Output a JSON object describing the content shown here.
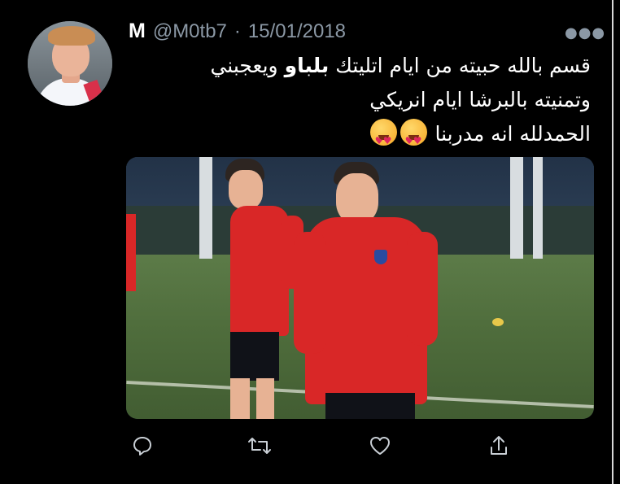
{
  "tweet": {
    "display_name": "M",
    "handle": "@M0tb7",
    "separator": "·",
    "date": "15/01/2018",
    "more_icon": "more-horizontal-icon",
    "text_lines": [
      {
        "before": "قسم بالله حبيته من ايام اتليتك ",
        "bold": "بلباو",
        "after": " ويعجبني"
      },
      {
        "before": "وتمنيته بالبرشا ايام انريكي",
        "bold": "",
        "after": ""
      },
      {
        "before": "الحمدلله انه مدربنا ",
        "bold": "",
        "after": ""
      }
    ],
    "emojis": [
      "heart-eyes-emoji",
      "heart-eyes-emoji"
    ],
    "media": {
      "kind": "photo",
      "subject": "coaches smiling on a training pitch"
    }
  },
  "actions": {
    "reply_icon": "reply-icon",
    "retweet_icon": "retweet-icon",
    "like_icon": "heart-icon",
    "share_icon": "share-icon"
  },
  "colors": {
    "background": "#000000",
    "text": "#ffffff",
    "muted": "#8b98a5"
  }
}
